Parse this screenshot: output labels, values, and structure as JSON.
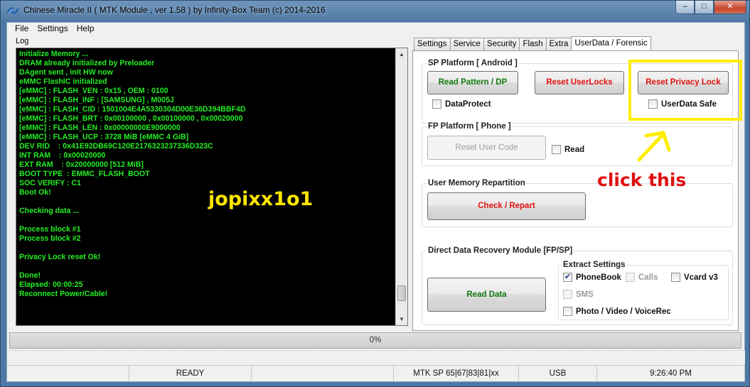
{
  "window": {
    "title": "Chinese Miracle II ( MTK Module , ver 1.58 ) by Infinity-Box Team (c) 2014-2016",
    "minimize": "–",
    "maximize": "□",
    "close": "✕"
  },
  "menu": {
    "items": [
      "File",
      "Settings",
      "Help"
    ]
  },
  "log": {
    "label": "Log",
    "lines": [
      "Initialize Memory ...",
      "DRAM already initialized by Preloader",
      "DAgent sent , init HW now",
      "eMMC FlashIC initialized",
      "[eMMC] : FLASH_VEN : 0x15 , OEM : 0100",
      "[eMMC] : FLASH_INF : [SAMSUNG] , M005J",
      "[eMMC] : FLASH_CID : 1501004E4A5330304D00E36D394BBF4D",
      "[eMMC] : FLASH_BRT : 0x00100000 , 0x00100000 , 0x00020000",
      "[eMMC] : FLASH_LEN : 0x00000000E9000000",
      "[eMMC] : FLASH_UCP : 3728 MiB [eMMC 4 GiB]",
      "DEV RID    : 0x41E92DB69C120E2176323237336D323C",
      "INT RAM    : 0x00020000",
      "EXT RAM    : 0x20000000 [512 MiB]",
      "BOOT TYPE  : EMMC_FLASH_BOOT",
      "SOC VERIFY : C1",
      "Boot Ok!",
      "",
      "Checking data ...",
      "",
      "Process block #1",
      "Process block #2",
      "",
      "Privacy Lock reset Ok!",
      "",
      "Done!",
      "Elapsed: 00:00:25",
      "Reconnect Power/Cable!"
    ],
    "watermark": "jopixx1o1"
  },
  "tabs": [
    "Settings",
    "Service",
    "Security",
    "Flash",
    "Extra",
    "UserData / Forensic"
  ],
  "sp_platform": {
    "title": "SP Platform [ Android ]",
    "read_pattern": "Read Pattern / DP",
    "reset_userlocks": "Reset UserLocks",
    "reset_privacy_lock": "Reset Privacy Lock",
    "data_protect": "DataProtect",
    "userdata_safe": "UserData Safe"
  },
  "fp_platform": {
    "title": "FP Platform [ Phone ]",
    "reset_user_code": "Reset User Code",
    "read": "Read"
  },
  "user_memory": {
    "title": "User Memory Repartition",
    "check_repart": "Check / Repart"
  },
  "ddr_module": {
    "title": "Direct Data Recovery Module  [FP/SP]",
    "read_data": "Read Data",
    "extract_title": "Extract Settings",
    "phonebook": "PhoneBook",
    "calls": "Calls",
    "vcard": "Vcard v3",
    "sms": "SMS",
    "photo": "Photo / Video / VoiceRec"
  },
  "annotation": {
    "click_this": "click this",
    "color": "#ffee00"
  },
  "progress": {
    "text": "0%"
  },
  "status": {
    "state": "READY",
    "protocol": "MTK SP 65|67|83|81|xx",
    "port": "USB",
    "time": "9:26:40 PM"
  },
  "colors": {
    "log_text": "#22ee22",
    "green_btn": "#107a10",
    "red_btn": "#e01010"
  }
}
